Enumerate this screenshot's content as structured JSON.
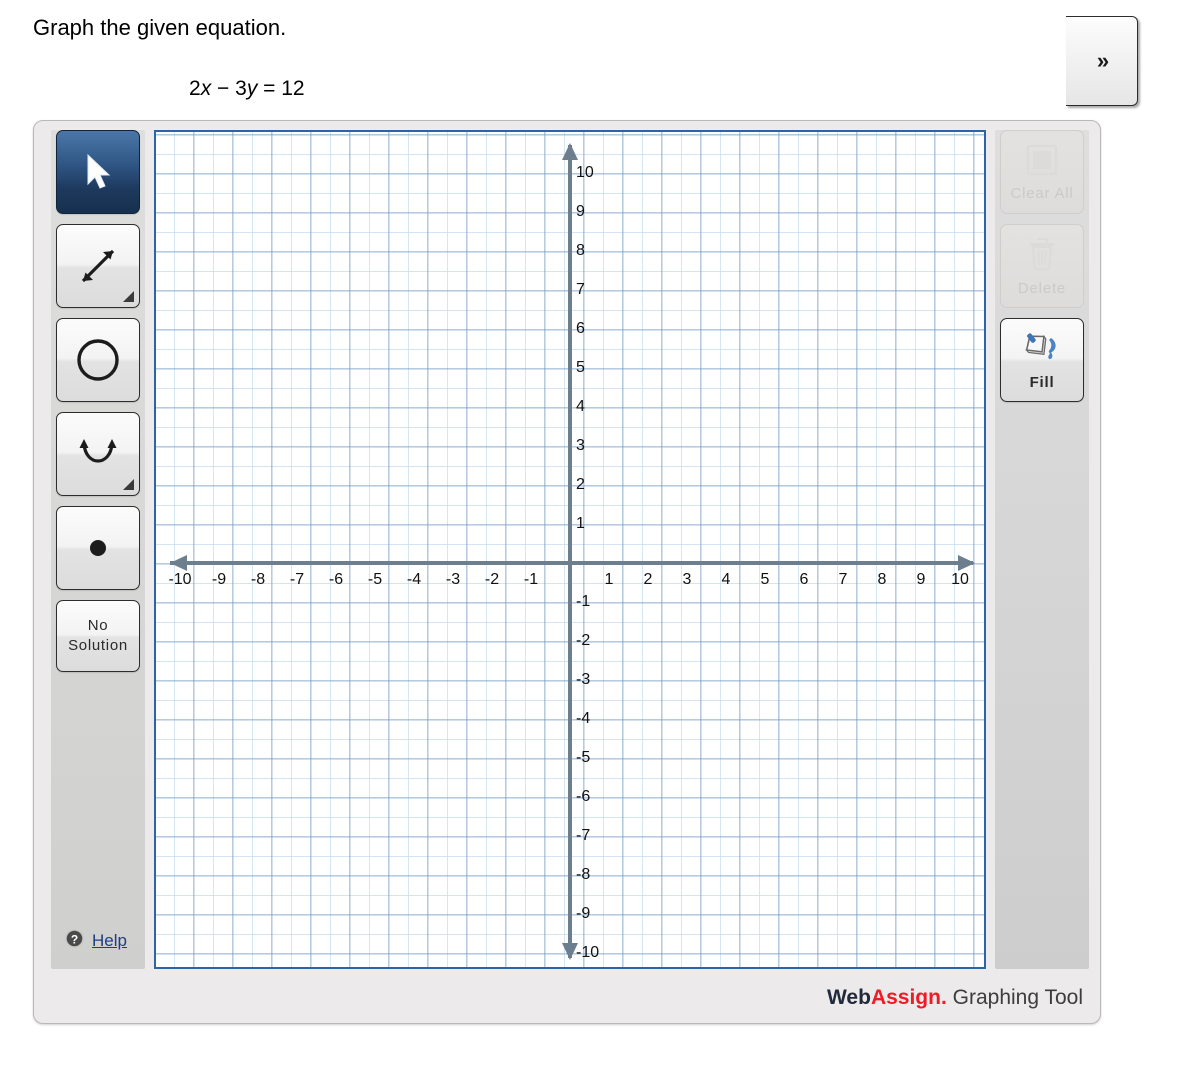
{
  "question": {
    "prompt": "Graph the given equation.",
    "equation_prefix": "2",
    "equation_var1": "x",
    "equation_mid": " − 3",
    "equation_var2": "y",
    "equation_suffix": " = 12",
    "equation_plain": "2x − 3y = 12"
  },
  "toolbar": {
    "tools": [
      {
        "name": "select",
        "label": "Select",
        "selected": true,
        "has_flyout": false
      },
      {
        "name": "line",
        "label": "Line",
        "selected": false,
        "has_flyout": true
      },
      {
        "name": "circle",
        "label": "Circle",
        "selected": false,
        "has_flyout": false
      },
      {
        "name": "parabola",
        "label": "Parabola",
        "selected": false,
        "has_flyout": true
      },
      {
        "name": "point",
        "label": "Point",
        "selected": false,
        "has_flyout": false
      }
    ],
    "no_solution_label_line1": "No",
    "no_solution_label_line2": "Solution",
    "help_label": "Help"
  },
  "actions": {
    "clear_all_label": "Clear All",
    "clear_all_enabled": false,
    "delete_label": "Delete",
    "delete_enabled": false,
    "fill_label": "Fill",
    "fill_enabled": true,
    "expand_label": "»"
  },
  "branding": {
    "web": "Web",
    "assign": "Assign.",
    "tool": " Graphing Tool"
  },
  "colors": {
    "accent_red": "#ee1c25",
    "accent_navy": "#222a3a",
    "grid_major": "#6d97c0",
    "grid_minor": "#c3dbee",
    "axis": "#6d7f8e",
    "canvas_border": "#2c64a8",
    "selected_tool": "#2f5584",
    "link": "#1f3d87"
  },
  "chart_data": {
    "type": "line",
    "title": "",
    "xlabel": "",
    "ylabel": "",
    "xlim": [
      -10.6,
      10.6
    ],
    "ylim": [
      -10.6,
      10.6
    ],
    "grid": true,
    "grid_major_step": 1,
    "grid_minor_step": 0.5,
    "legend": "none",
    "x_ticks": [
      -10,
      -9,
      -8,
      -7,
      -6,
      -5,
      -4,
      -3,
      -2,
      -1,
      1,
      2,
      3,
      4,
      5,
      6,
      7,
      8,
      9,
      10
    ],
    "y_ticks": [
      10,
      9,
      8,
      7,
      6,
      5,
      4,
      3,
      2,
      1,
      -1,
      -2,
      -3,
      -4,
      -5,
      -6,
      -7,
      -8,
      -9,
      -10
    ],
    "x_tick_labels": [
      "-10",
      "-9",
      "-8",
      "-7",
      "-6",
      "-5",
      "-4",
      "-3",
      "-2",
      "-1",
      "1",
      "2",
      "3",
      "4",
      "5",
      "6",
      "7",
      "8",
      "9",
      "10"
    ],
    "y_tick_labels": [
      "10",
      "9",
      "8",
      "7",
      "6",
      "5",
      "4",
      "3",
      "2",
      "1",
      "-1",
      "-2",
      "-3",
      "-4",
      "-5",
      "-6",
      "-7",
      "-8",
      "-9",
      "-10"
    ],
    "series": [],
    "annotations": [],
    "axis_arrows": [
      "left",
      "right",
      "up",
      "down"
    ]
  }
}
